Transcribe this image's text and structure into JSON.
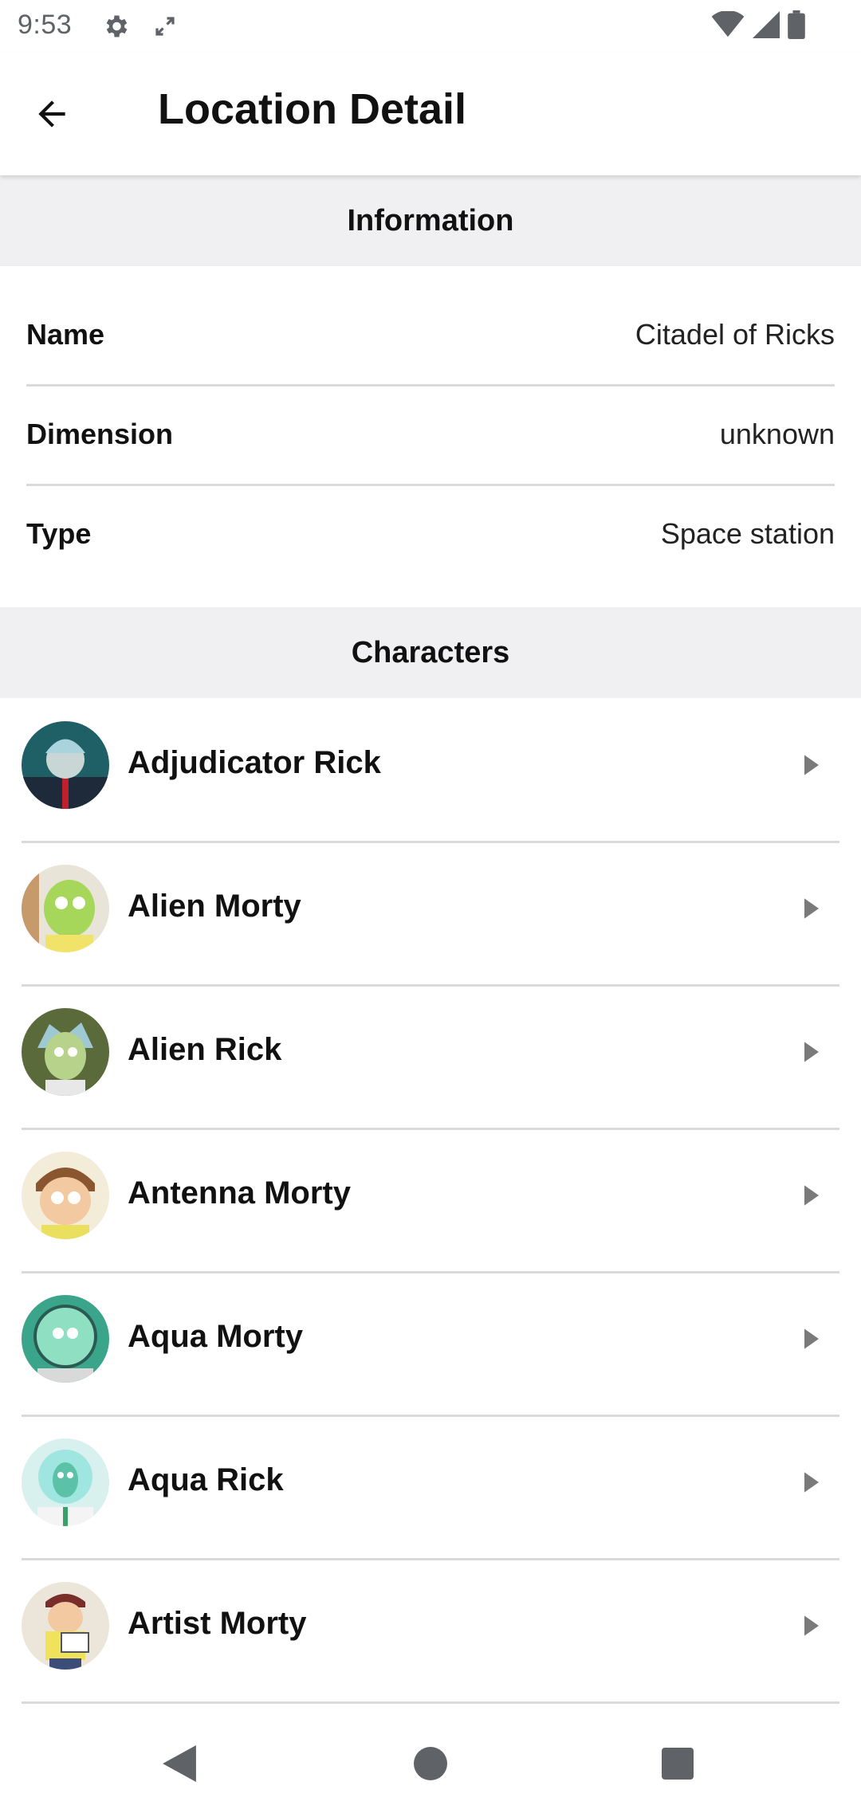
{
  "status_bar": {
    "time": "9:53",
    "icons": [
      "settings-icon",
      "screen-rotate-icon",
      "wifi-icon",
      "signal-icon",
      "battery-icon"
    ]
  },
  "app_bar": {
    "back_icon": "arrow-back-icon",
    "title": "Location Detail"
  },
  "information": {
    "header": "Information",
    "rows": [
      {
        "label": "Name",
        "value": "Citadel of Ricks"
      },
      {
        "label": "Dimension",
        "value": "unknown"
      },
      {
        "label": "Type",
        "value": "Space station"
      }
    ]
  },
  "characters": {
    "header": "Characters",
    "items": [
      {
        "name": "Adjudicator Rick"
      },
      {
        "name": "Alien Morty"
      },
      {
        "name": "Alien Rick"
      },
      {
        "name": "Antenna Morty"
      },
      {
        "name": "Aqua Morty"
      },
      {
        "name": "Aqua Rick"
      },
      {
        "name": "Artist Morty"
      }
    ]
  },
  "nav_bar": {
    "icons": [
      "nav-back-icon",
      "nav-home-icon",
      "nav-recents-icon"
    ]
  },
  "colors": {
    "section_bg": "#f0f0f2",
    "divider": "#dadada",
    "status_icon": "#5f6368",
    "chevron": "#7a7a7a"
  }
}
